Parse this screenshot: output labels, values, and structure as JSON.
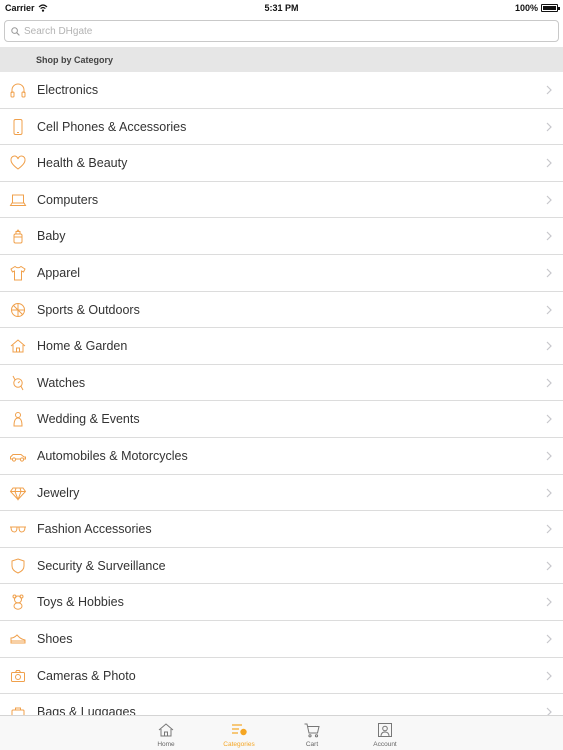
{
  "status_bar": {
    "carrier": "Carrier",
    "time": "5:31 PM",
    "battery": "100%"
  },
  "search": {
    "placeholder": "Search DHgate"
  },
  "section": {
    "title": "Shop by Category"
  },
  "categories": [
    {
      "label": "Electronics",
      "icon": "headphones-icon"
    },
    {
      "label": "Cell Phones & Accessories",
      "icon": "phone-icon"
    },
    {
      "label": "Health & Beauty",
      "icon": "heart-icon"
    },
    {
      "label": "Computers",
      "icon": "laptop-icon"
    },
    {
      "label": "Baby",
      "icon": "baby-bottle-icon"
    },
    {
      "label": "Apparel",
      "icon": "tshirt-icon"
    },
    {
      "label": "Sports & Outdoors",
      "icon": "ball-icon"
    },
    {
      "label": "Home & Garden",
      "icon": "house-icon"
    },
    {
      "label": "Watches",
      "icon": "watch-icon"
    },
    {
      "label": "Wedding & Events",
      "icon": "wedding-icon"
    },
    {
      "label": "Automobiles & Motorcycles",
      "icon": "car-icon"
    },
    {
      "label": "Jewelry",
      "icon": "diamond-icon"
    },
    {
      "label": "Fashion Accessories",
      "icon": "sunglasses-icon"
    },
    {
      "label": "Security & Surveillance",
      "icon": "shield-icon"
    },
    {
      "label": "Toys & Hobbies",
      "icon": "teddy-bear-icon"
    },
    {
      "label": "Shoes",
      "icon": "shoe-icon"
    },
    {
      "label": "Cameras & Photo",
      "icon": "camera-icon"
    },
    {
      "label": "Bags & Luggages",
      "icon": "bag-icon"
    }
  ],
  "tabs": [
    {
      "label": "Home",
      "icon": "home-icon",
      "active": false
    },
    {
      "label": "Categories",
      "icon": "categories-icon",
      "active": true
    },
    {
      "label": "Cart",
      "icon": "cart-icon",
      "active": false
    },
    {
      "label": "Account",
      "icon": "account-icon",
      "active": false
    }
  ],
  "colors": {
    "accent": "#f5a623",
    "icon_stroke": "#f0a04b",
    "header_bg": "#e6e6e6",
    "divider": "#dcdcdc"
  }
}
